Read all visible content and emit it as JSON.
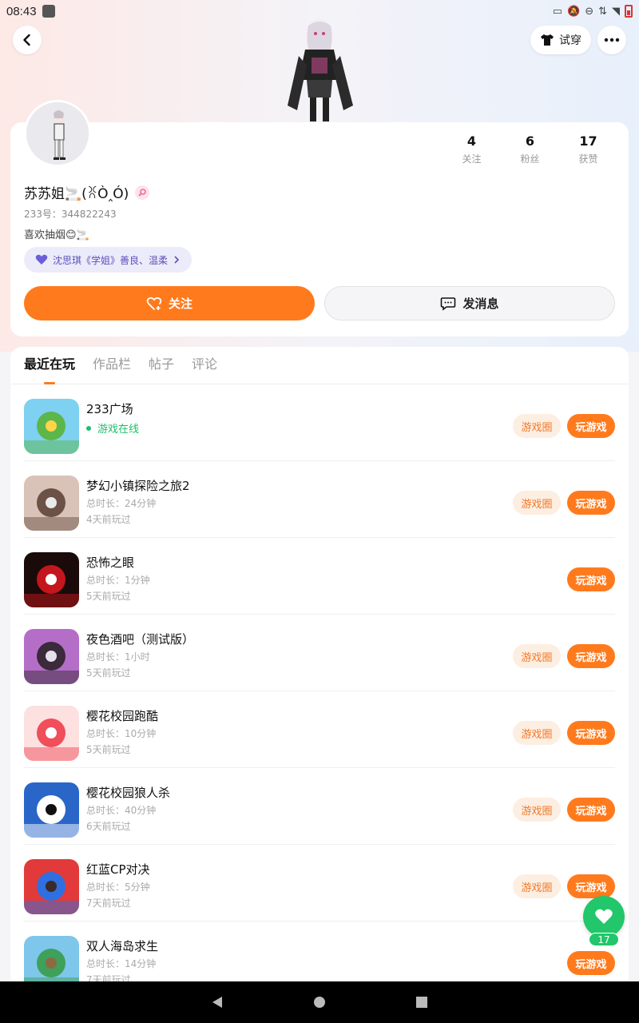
{
  "status_bar": {
    "time": "08:43"
  },
  "header": {
    "tryon_label": "试穿"
  },
  "profile": {
    "stats": [
      {
        "num": "4",
        "label": "关注"
      },
      {
        "num": "6",
        "label": "粉丝"
      },
      {
        "num": "17",
        "label": "获赞"
      }
    ],
    "nickname": "苏苏姐🚬(ꐦÒ‸Ó)",
    "id_line": "233号：344822243",
    "bio": "喜欢抽烟😊🚬",
    "role_tag": "沈思琪《学姐》善良、温柔",
    "follow_label": "关注",
    "message_label": "发消息"
  },
  "tabs": [
    "最近在玩",
    "作品栏",
    "帖子",
    "评论"
  ],
  "games": [
    {
      "name": "233广场",
      "online": "游戏在线",
      "duration": "",
      "last": "",
      "has_circle": true,
      "icon_colors": [
        "#7ed1f0",
        "#5cb64a",
        "#ffd34a"
      ]
    },
    {
      "name": "梦幻小镇探险之旅2",
      "online": "",
      "duration": "总时长：24分钟",
      "last": "4天前玩过",
      "has_circle": true,
      "icon_colors": [
        "#d9c3b8",
        "#6b5146",
        "#eaeaea"
      ]
    },
    {
      "name": "恐怖之眼",
      "online": "",
      "duration": "总时长：1分钟",
      "last": "5天前玩过",
      "has_circle": false,
      "icon_colors": [
        "#1a0a0a",
        "#c4161c",
        "#ffffff"
      ]
    },
    {
      "name": "夜色酒吧（测试版）",
      "online": "",
      "duration": "总时长：1小时",
      "last": "5天前玩过",
      "has_circle": true,
      "icon_colors": [
        "#b46ec8",
        "#3a2a3a",
        "#e6e0ea"
      ]
    },
    {
      "name": "樱花校园跑酷",
      "online": "",
      "duration": "总时长：10分钟",
      "last": "5天前玩过",
      "has_circle": true,
      "icon_colors": [
        "#fde0e0",
        "#ef4e5a",
        "#ffffff"
      ]
    },
    {
      "name": "樱花校园狼人杀",
      "online": "",
      "duration": "总时长：40分钟",
      "last": "6天前玩过",
      "has_circle": true,
      "icon_colors": [
        "#2a66c8",
        "#ffffff",
        "#111111"
      ]
    },
    {
      "name": "红蓝CP对决",
      "online": "",
      "duration": "总时长：5分钟",
      "last": "7天前玩过",
      "has_circle": true,
      "icon_colors": [
        "#e23a3a",
        "#2f6fe0",
        "#3a2a2a"
      ]
    },
    {
      "name": "双人海岛求生",
      "online": "",
      "duration": "总时长：14分钟",
      "last": "7天前玩过",
      "has_circle": false,
      "icon_colors": [
        "#7ec6ea",
        "#3fa05a",
        "#8b6a44"
      ]
    }
  ],
  "buttons": {
    "circle_label": "游戏圈",
    "play_label": "玩游戏"
  },
  "like_fab": {
    "count": "17"
  },
  "colors": {
    "accent": "#ff7a1c",
    "online_green": "#1fbe6a",
    "fab_green": "#21c76a"
  }
}
